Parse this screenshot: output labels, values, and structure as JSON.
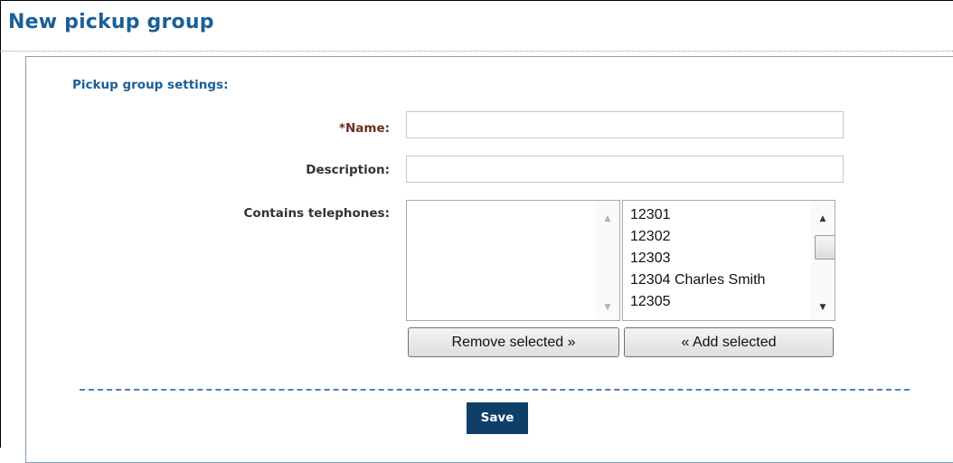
{
  "page": {
    "title": "New pickup group"
  },
  "form": {
    "section_heading": "Pickup group settings:",
    "name_label": "*Name:",
    "name_value": "",
    "description_label": "Description:",
    "description_value": "",
    "telephones_label": "Contains telephones:",
    "selected_telephones": [],
    "available_telephones": [
      "12301",
      "12302",
      "12303",
      "12304 Charles Smith",
      "12305"
    ],
    "remove_button": "Remove selected »",
    "add_button": "« Add selected",
    "save_button": "Save"
  },
  "colors": {
    "title_blue": "#1b5f96",
    "required_label": "#6b2e1f",
    "save_button_bg": "#0e3f68",
    "panel_border": "#7f9db9"
  },
  "icons": {
    "scroll_up": "scroll-up-icon",
    "scroll_down": "scroll-down-icon"
  }
}
